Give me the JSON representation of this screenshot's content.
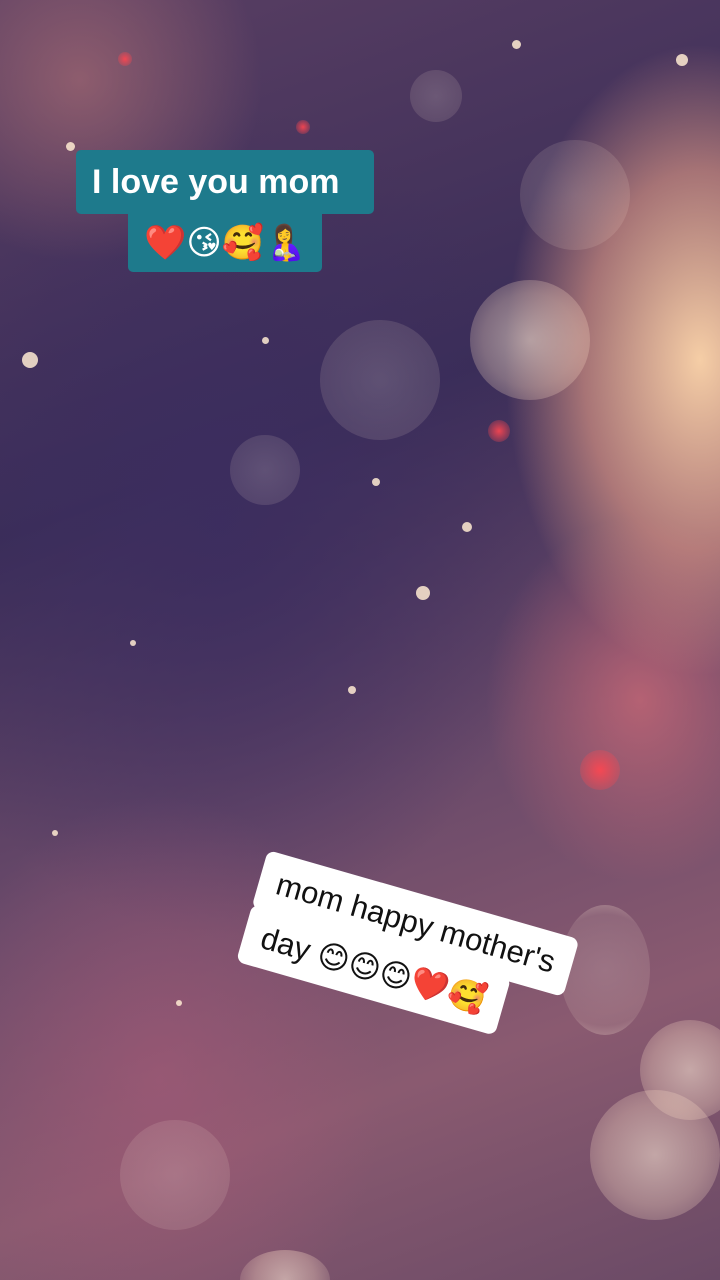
{
  "captions": {
    "top_line1": "I love you mom",
    "top_line2": "❤️😘🥰🤱",
    "bottom_line1": "mom happy mother's",
    "bottom_line2": "day 😊😊😊❤️🥰"
  }
}
